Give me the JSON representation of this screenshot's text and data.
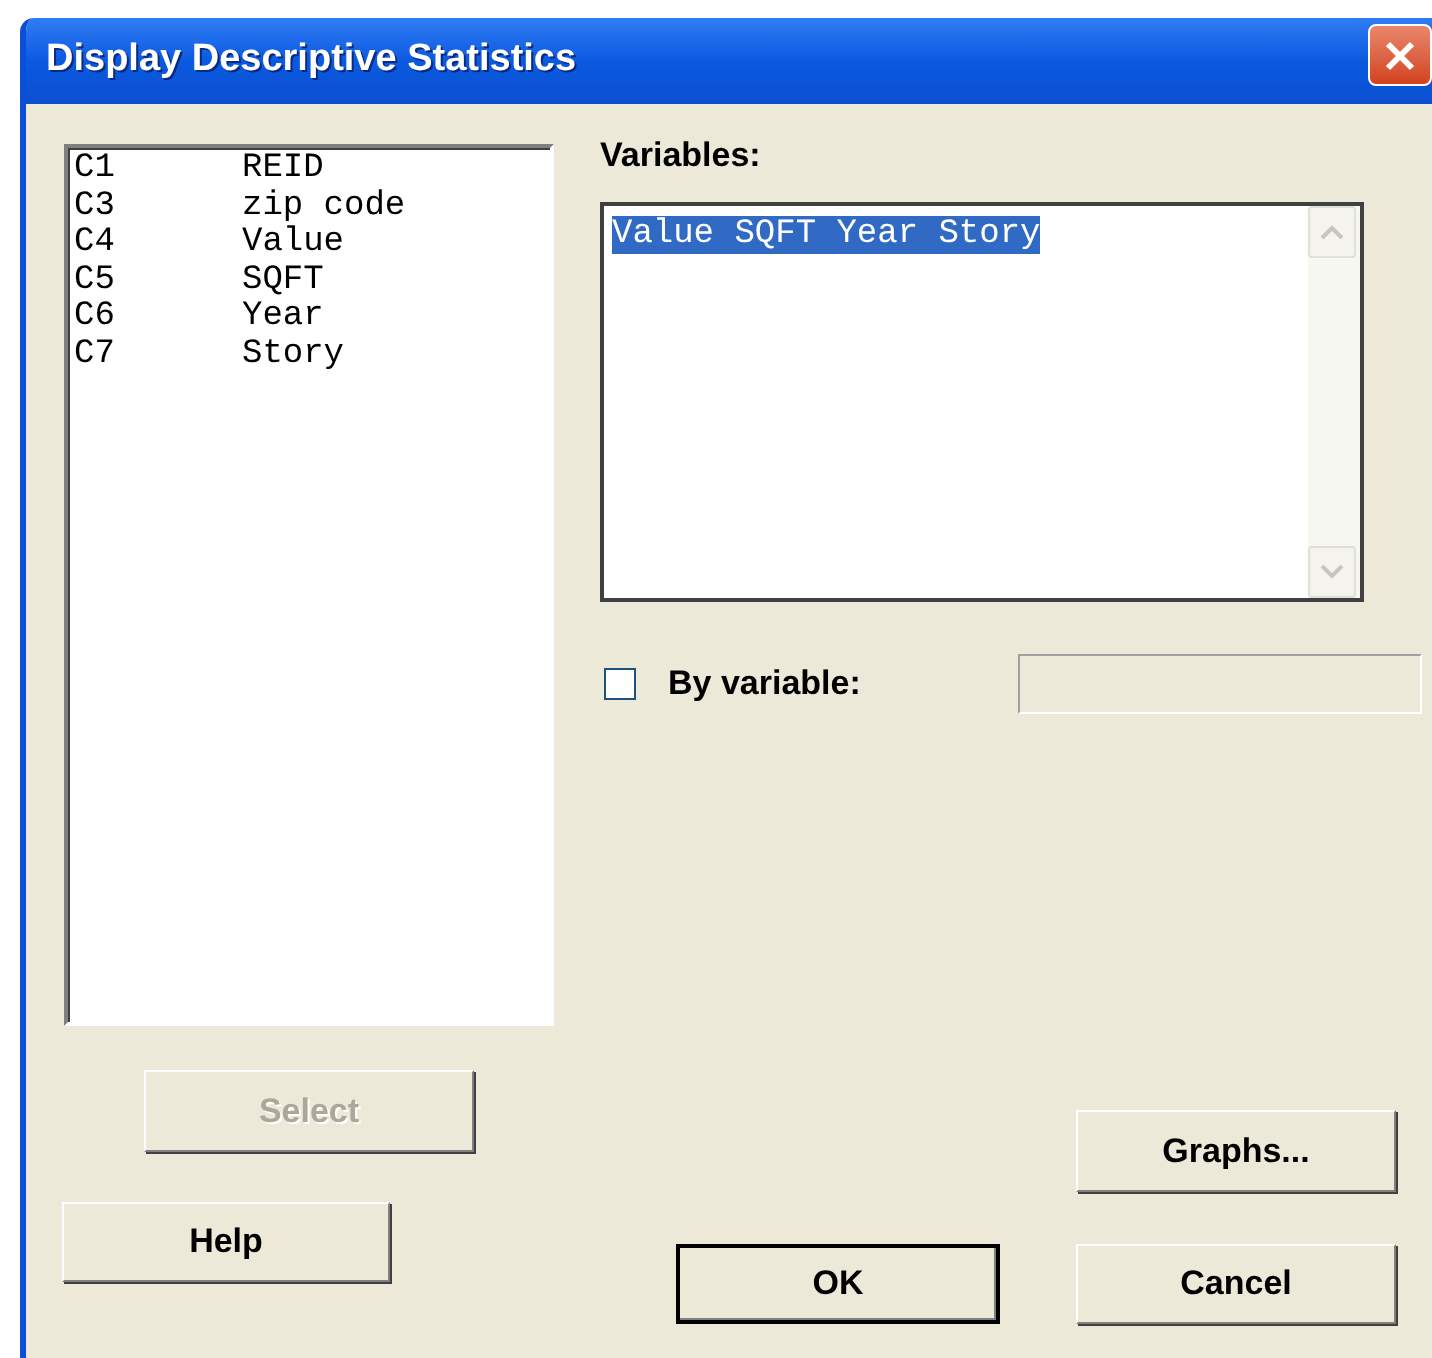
{
  "window": {
    "title": "Display Descriptive Statistics"
  },
  "column_list": [
    {
      "column": "C1",
      "name": "REID"
    },
    {
      "column": "C3",
      "name": "zip code"
    },
    {
      "column": "C4",
      "name": "Value"
    },
    {
      "column": "C5",
      "name": "SQFT"
    },
    {
      "column": "C6",
      "name": "Year"
    },
    {
      "column": "C7",
      "name": "Story"
    }
  ],
  "variables": {
    "label": "Variables:",
    "value": "Value SQFT Year Story",
    "selected": true
  },
  "by_variable": {
    "label": "By variable:",
    "checked": false
  },
  "buttons": {
    "select": {
      "label": "Select",
      "disabled": true,
      "default": false
    },
    "help": {
      "label": "Help",
      "disabled": false,
      "default": false
    },
    "graphs": {
      "label": "Graphs...",
      "disabled": false,
      "default": false
    },
    "ok": {
      "label": "OK",
      "disabled": false,
      "default": true
    },
    "cancel": {
      "label": "Cancel",
      "disabled": false,
      "default": false
    }
  }
}
